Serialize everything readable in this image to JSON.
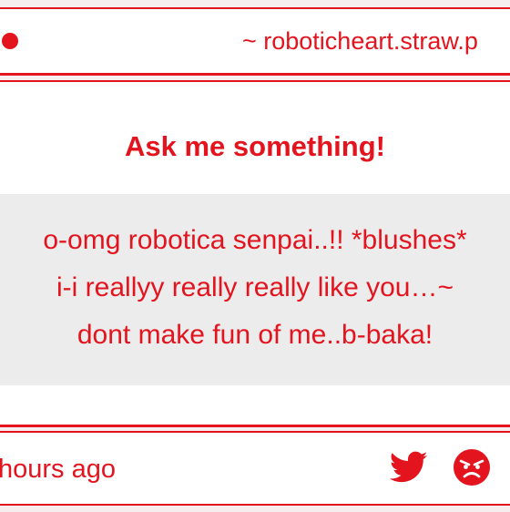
{
  "header": {
    "url": "~ roboticheart.straw.p"
  },
  "card": {
    "title": "Ask me something!",
    "question_lines": [
      "o-omg robotica senpai..!! *blushes*",
      "i-i reallyy really really like you…~",
      "dont make fun of me..b-baka!"
    ]
  },
  "footer": {
    "timestamp": "hours ago",
    "icons": [
      "twitter-icon",
      "angry-face-icon"
    ]
  },
  "colors": {
    "accent": "#e3141e",
    "question_bg": "#ececec",
    "page_bg": "#ffffff"
  }
}
